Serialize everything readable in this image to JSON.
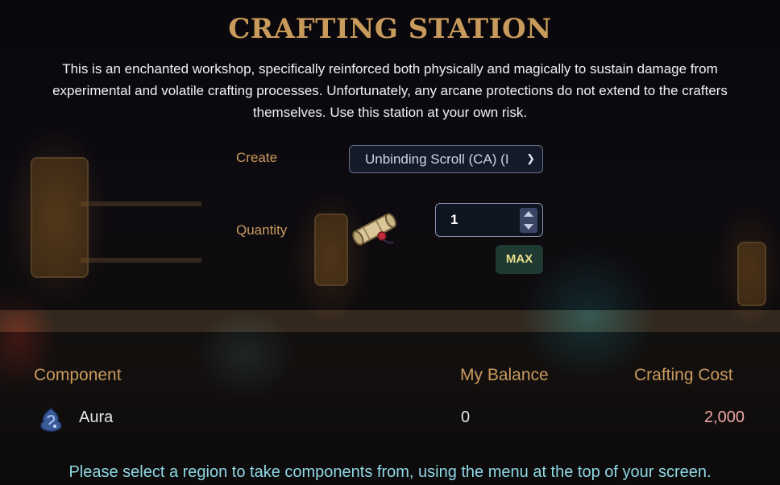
{
  "header": {
    "title": "CRAFTING STATION",
    "description": "This is an enchanted workshop, specifically reinforced both physically and magically to sustain damage from experimental and volatile crafting processes. Unfortunately, any arcane protections do not extend to the crafters themselves. Use this station at your own risk."
  },
  "form": {
    "create_label": "Create",
    "create_selected": "Unbinding Scroll (CA) (I",
    "quantity_label": "Quantity",
    "quantity_value": "1",
    "max_label": "MAX",
    "item_icon": "scroll-icon"
  },
  "table": {
    "headers": [
      "Component",
      "My Balance",
      "Crafting Cost"
    ],
    "rows": [
      {
        "icon": "aura-icon",
        "component": "Aura",
        "balance": "0",
        "cost": "2,000"
      }
    ]
  },
  "footer": {
    "note": "Please select a region to take components from, using the menu at the top of your screen."
  },
  "colors": {
    "title": "#c89a5b",
    "label": "#c99a5e",
    "cost": "#f2a6a6",
    "note": "#8fd8e4",
    "max_button_bg": "#1e3a33"
  }
}
